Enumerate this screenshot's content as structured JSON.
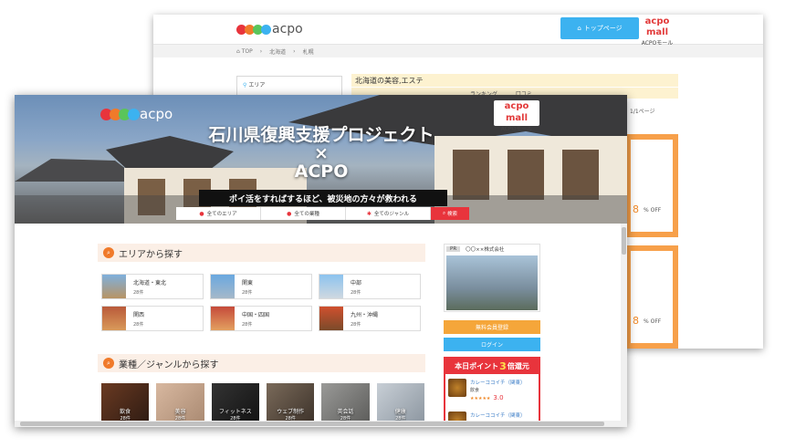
{
  "colors": {
    "red": "#e8343c",
    "green": "#5ac55a",
    "orange": "#f07a2a",
    "blue": "#3cb2f0",
    "accent": "#f5a63a"
  },
  "back": {
    "logo_text": "acpo",
    "top_button": "トップページ",
    "mall_icon": "acpo mall",
    "mall_label": "ACPOモール",
    "breadcrumb": [
      "TOP",
      "北海道",
      "札幌"
    ],
    "sidebar_label": "エリア",
    "title": "北海道の美容,エステ",
    "tabs": [
      "ランキング",
      "口コミ"
    ],
    "page_info": "1/1ページ",
    "card1_pct": "8",
    "card1_off": "% OFF",
    "card2_pct": "8",
    "card2_off": "% OFF"
  },
  "front": {
    "logo_text": "acpo",
    "mall_icon": "acpo mall",
    "mall_label": "ACPOモール",
    "hero_title_1": "石川県復興支援プロジェクト",
    "hero_title_2": "×",
    "hero_title_3": "ACPO",
    "hero_sub": "ポイ活をすればするほど、被災地の方々が救われる",
    "search": {
      "area": "全てのエリア",
      "industry": "全ての業種",
      "genre": "全てのジャンル",
      "button": "検索"
    },
    "area_section": "エリアから探す",
    "areas": [
      {
        "name": "北海道・東北",
        "count": "28件"
      },
      {
        "name": "関東",
        "count": "28件"
      },
      {
        "name": "中部",
        "count": "28件"
      },
      {
        "name": "関西",
        "count": "28件"
      },
      {
        "name": "中国・四国",
        "count": "28件"
      },
      {
        "name": "九州・沖縄",
        "count": "28件"
      }
    ],
    "genre_section": "業種／ジャンルから探す",
    "genres": [
      {
        "name": "飲食",
        "count": "28件"
      },
      {
        "name": "美容",
        "count": "28件"
      },
      {
        "name": "フィットネス",
        "count": "28件"
      },
      {
        "name": "ウェブ制作",
        "count": "28件"
      },
      {
        "name": "英会話",
        "count": "28件"
      },
      {
        "name": "健康",
        "count": "28件"
      }
    ],
    "ad": {
      "pr": "PR",
      "company": "〇〇××株式会社"
    },
    "register_button": "無料会員登録",
    "login_button": "ログイン",
    "points_head_pre": "本日ポイント",
    "points_head_big": "3",
    "points_head_post": "倍還元",
    "point_items": [
      {
        "name": "カレーココイチ（関東）",
        "category": "飲食",
        "stars": "★★★★★",
        "rating": "3.0"
      },
      {
        "name": "カレーココイチ（関東）"
      }
    ]
  }
}
